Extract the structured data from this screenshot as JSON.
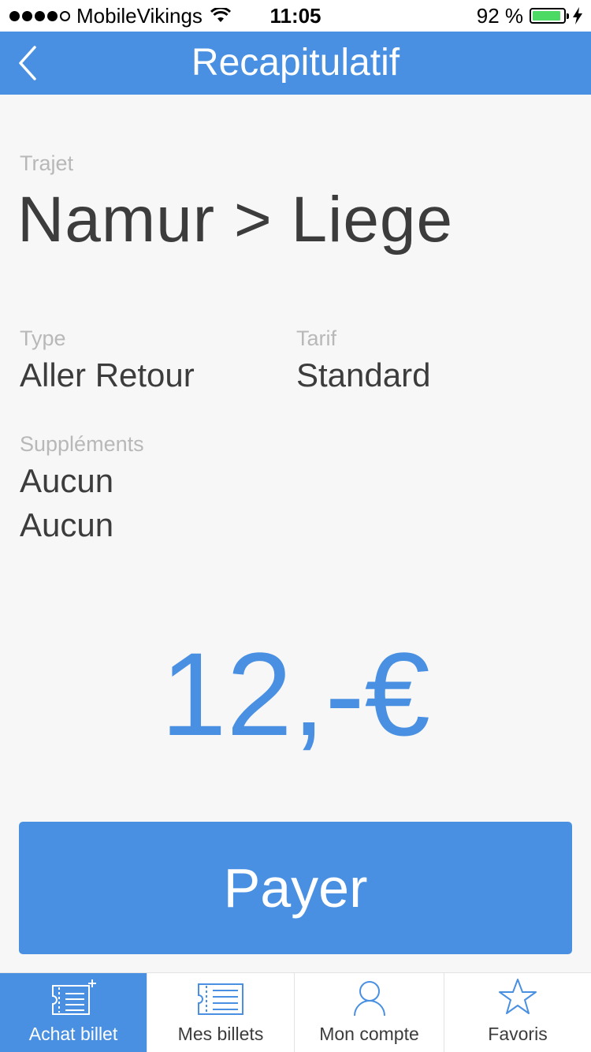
{
  "status_bar": {
    "carrier": "MobileVikings",
    "time": "11:05",
    "battery_percent": "92 %",
    "battery_level": 0.92,
    "signal_bars_filled": 4
  },
  "nav": {
    "title": "Recapitulatif",
    "back_icon": "chevron-left-icon"
  },
  "summary": {
    "trajet_label": "Trajet",
    "trajet_value": "Namur > Liege",
    "type_label": "Type",
    "type_value": "Aller Retour",
    "tarif_label": "Tarif",
    "tarif_value": "Standard",
    "supplements_label": "Suppléments",
    "supplements": [
      "Aucun",
      "Aucun"
    ]
  },
  "price": "12,-€",
  "pay_button_label": "Payer",
  "tabs": [
    {
      "label": "Achat billet",
      "icon": "ticket-add-icon",
      "active": true
    },
    {
      "label": "Mes billets",
      "icon": "ticket-icon",
      "active": false
    },
    {
      "label": "Mon compte",
      "icon": "user-icon",
      "active": false
    },
    {
      "label": "Favoris",
      "icon": "star-icon",
      "active": false
    }
  ],
  "colors": {
    "accent": "#4a90e2",
    "battery": "#4cd964",
    "label": "#b8b8b8",
    "text": "#3c3c3c"
  }
}
